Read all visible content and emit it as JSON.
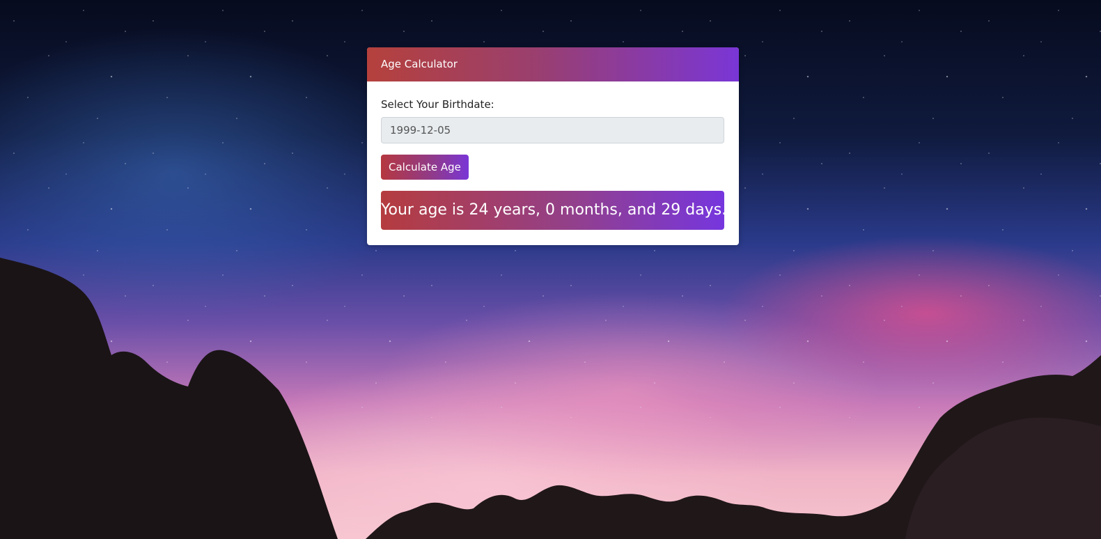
{
  "card": {
    "title": "Age Calculator"
  },
  "form": {
    "birthdate_label": "Select Your Birthdate:",
    "birthdate_value": "1999-12-05",
    "calculate_button_label": "Calculate Age"
  },
  "result": {
    "text": "Your age is 24 years, 0 months, and 29 days."
  },
  "theme": {
    "header_gradient_start": "#b5413c",
    "header_gradient_end": "#7a36d6"
  }
}
